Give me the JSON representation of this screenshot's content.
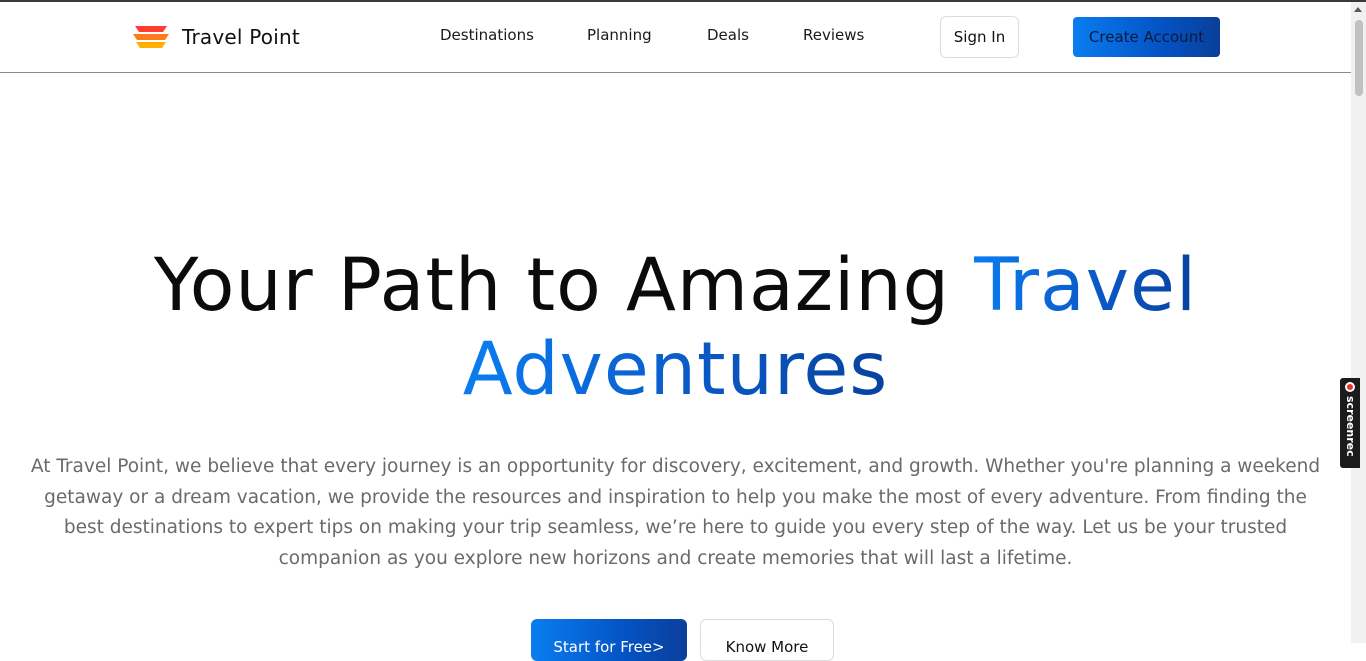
{
  "brand": {
    "name": "Travel Point",
    "logo_colors": [
      "#ff3d2e",
      "#ff7a1a",
      "#ffb000"
    ]
  },
  "nav": {
    "links": [
      {
        "label": "Destinations"
      },
      {
        "label": "Planning"
      },
      {
        "label": "Deals"
      },
      {
        "label": "Reviews"
      }
    ],
    "sign_in": "Sign In",
    "create_account": "Create Account"
  },
  "hero": {
    "title_part1": "Your Path to Amazing ",
    "title_accent_line1": "Travel",
    "title_accent_line2": "Adventures",
    "description": "At Travel Point, we believe that every journey is an opportunity for discovery, excitement, and growth. Whether you're planning a weekend getaway or a dream vacation, we provide the resources and inspiration to help you make the most of every adventure. From finding the best destinations to expert tips on making your trip seamless, we’re here to guide you every step of the way. Let us be your trusted companion as you explore new horizons and create memories that will last a lifetime.",
    "cta_primary": "Start for Free>",
    "cta_secondary": "Know More"
  },
  "overlay": {
    "recorder_label": "screenrec"
  },
  "colors": {
    "accent_start": "#0a7df0",
    "accent_end": "#06429e",
    "text_muted": "#6a6a6a"
  }
}
